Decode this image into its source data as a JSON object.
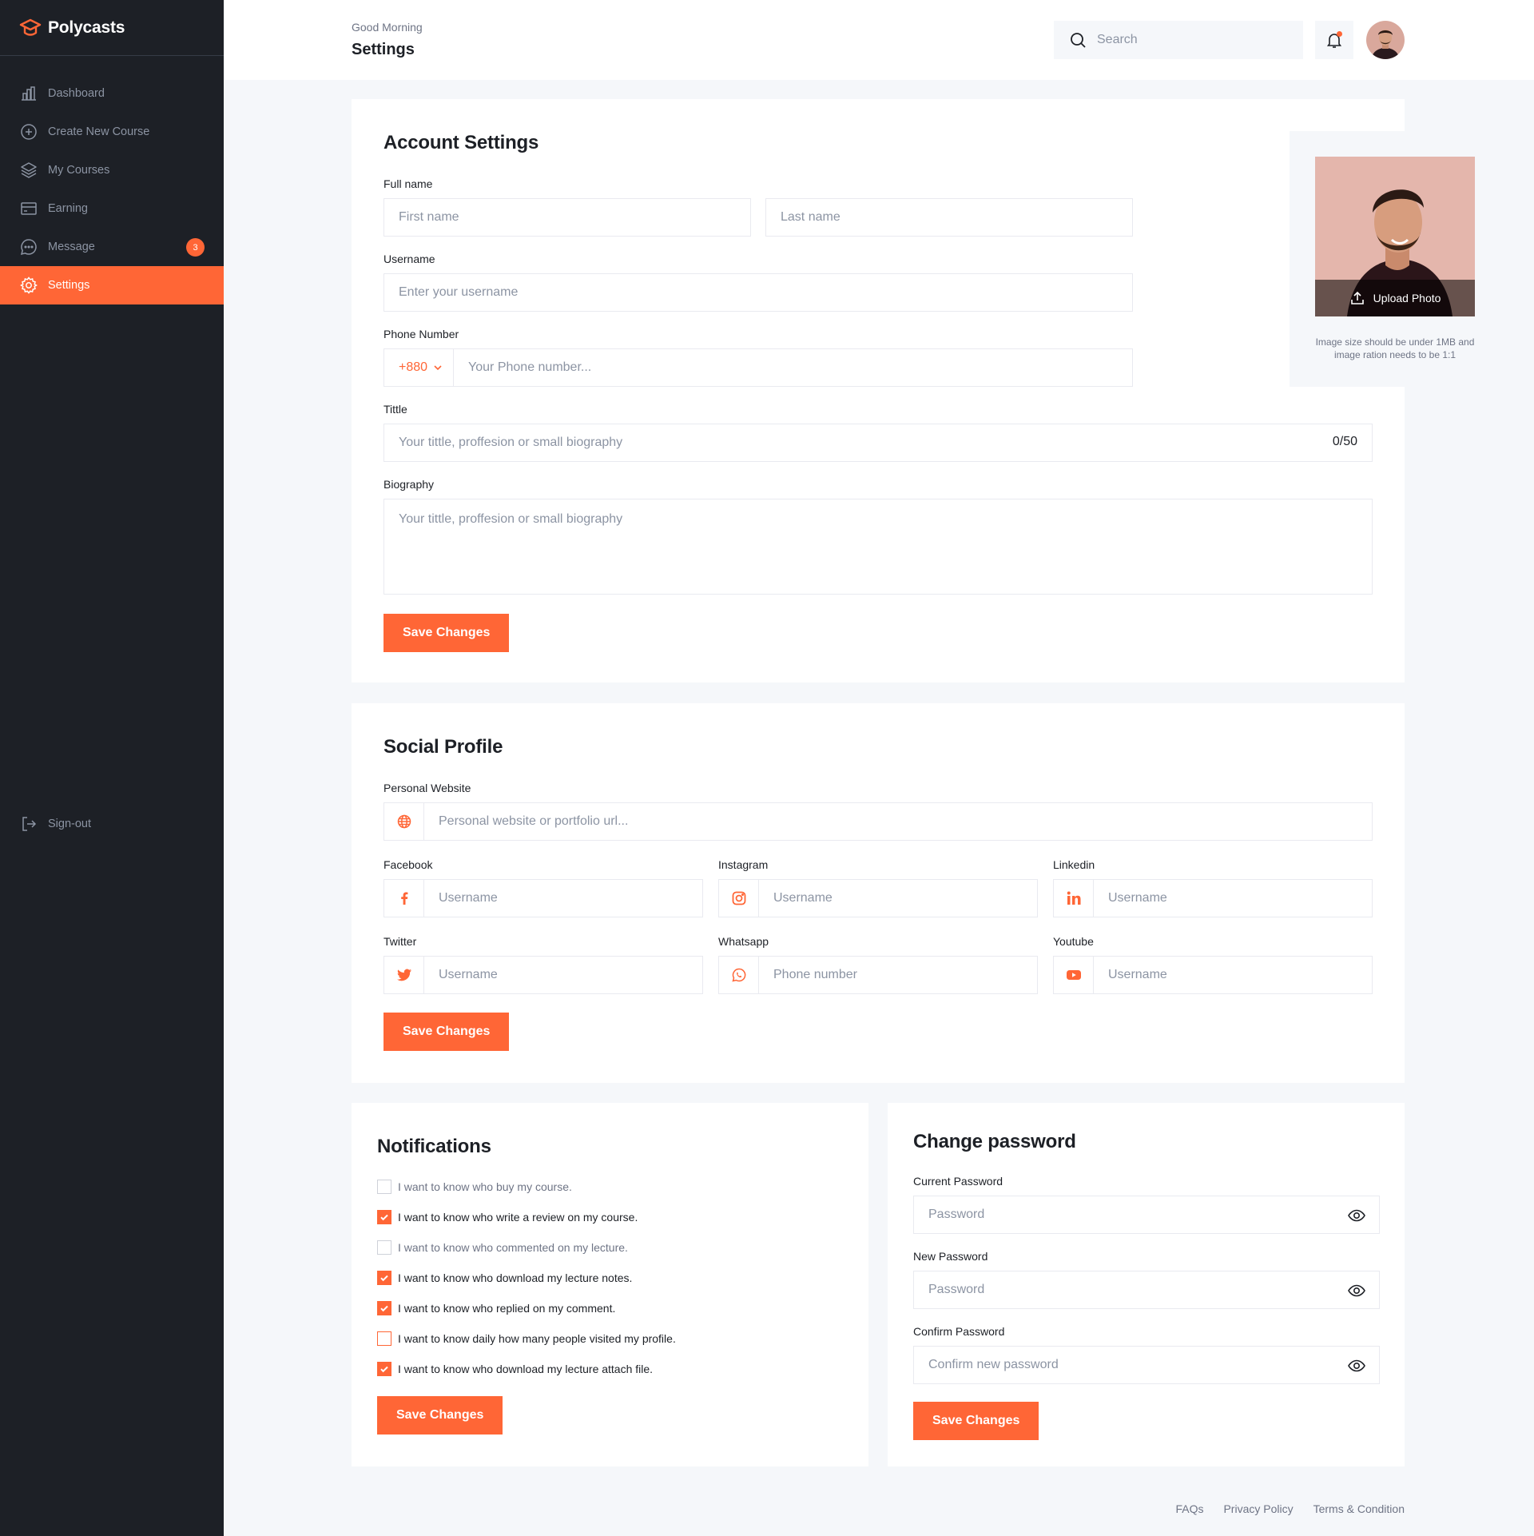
{
  "brand": {
    "name": "Polycasts"
  },
  "sidebar": {
    "items": [
      {
        "label": "Dashboard",
        "icon": "chart-bar-icon"
      },
      {
        "label": "Create New Course",
        "icon": "plus-circle-icon"
      },
      {
        "label": "My Courses",
        "icon": "stack-icon"
      },
      {
        "label": "Earning",
        "icon": "credit-card-icon"
      },
      {
        "label": "Message",
        "icon": "chat-icon",
        "badge": "3"
      },
      {
        "label": "Settings",
        "icon": "gear-icon",
        "active": true
      }
    ],
    "signout": "Sign-out"
  },
  "header": {
    "greeting": "Good Morning",
    "title": "Settings",
    "search_placeholder": "Search"
  },
  "account": {
    "title": "Account Settings",
    "fullname_label": "Full name",
    "first_placeholder": "First name",
    "last_placeholder": "Last name",
    "username_label": "Username",
    "username_placeholder": "Enter your username",
    "phone_label": "Phone Number",
    "phone_code": "+880",
    "phone_placeholder": "Your Phone number...",
    "title_label": "Tittle",
    "title_placeholder": "Your tittle, proffesion or small biography",
    "title_counter": "0/50",
    "bio_label": "Biography",
    "bio_placeholder": "Your tittle, proffesion or small biography",
    "save": "Save Changes",
    "upload_label": "Upload Photo",
    "photo_note": "Image size should be under 1MB and image ration needs to be 1:1"
  },
  "social": {
    "title": "Social Profile",
    "website_label": "Personal Website",
    "website_placeholder": "Personal website or portfolio url...",
    "fields": [
      {
        "label": "Facebook",
        "placeholder": "Username",
        "icon": "facebook-icon"
      },
      {
        "label": "Instagram",
        "placeholder": "Username",
        "icon": "instagram-icon"
      },
      {
        "label": "Linkedin",
        "placeholder": "Username",
        "icon": "linkedin-icon"
      },
      {
        "label": "Twitter",
        "placeholder": "Username",
        "icon": "twitter-icon"
      },
      {
        "label": "Whatsapp",
        "placeholder": "Phone number",
        "icon": "whatsapp-icon"
      },
      {
        "label": "Youtube",
        "placeholder": "Username",
        "icon": "youtube-icon"
      }
    ],
    "save": "Save Changes"
  },
  "notifications": {
    "title": "Notifications",
    "items": [
      {
        "text": "I want to know who buy my course.",
        "checked": false
      },
      {
        "text": "I want to know who write a review on my course.",
        "checked": true
      },
      {
        "text": "I want to know who commented on my lecture.",
        "checked": false
      },
      {
        "text": "I want to know who download my lecture notes.",
        "checked": true
      },
      {
        "text": "I want to know who replied on my comment.",
        "checked": true
      },
      {
        "text": "I want to know daily how many people visited my profile.",
        "checked": false
      },
      {
        "text": "I want to know who download my lecture attach file.",
        "checked": true
      }
    ],
    "save": "Save Changes"
  },
  "password": {
    "title": "Change password",
    "current_label": "Current Password",
    "current_placeholder": "Password",
    "new_label": "New Password",
    "new_placeholder": "Password",
    "confirm_label": "Confirm Password",
    "confirm_placeholder": "Confirm new password",
    "save": "Save Changes"
  },
  "footer": {
    "links": [
      "FAQs",
      "Privacy Policy",
      "Terms & Condition"
    ]
  },
  "colors": {
    "accent": "#ff6636",
    "sidebar": "#1d2026",
    "background": "#f5f7fa"
  }
}
